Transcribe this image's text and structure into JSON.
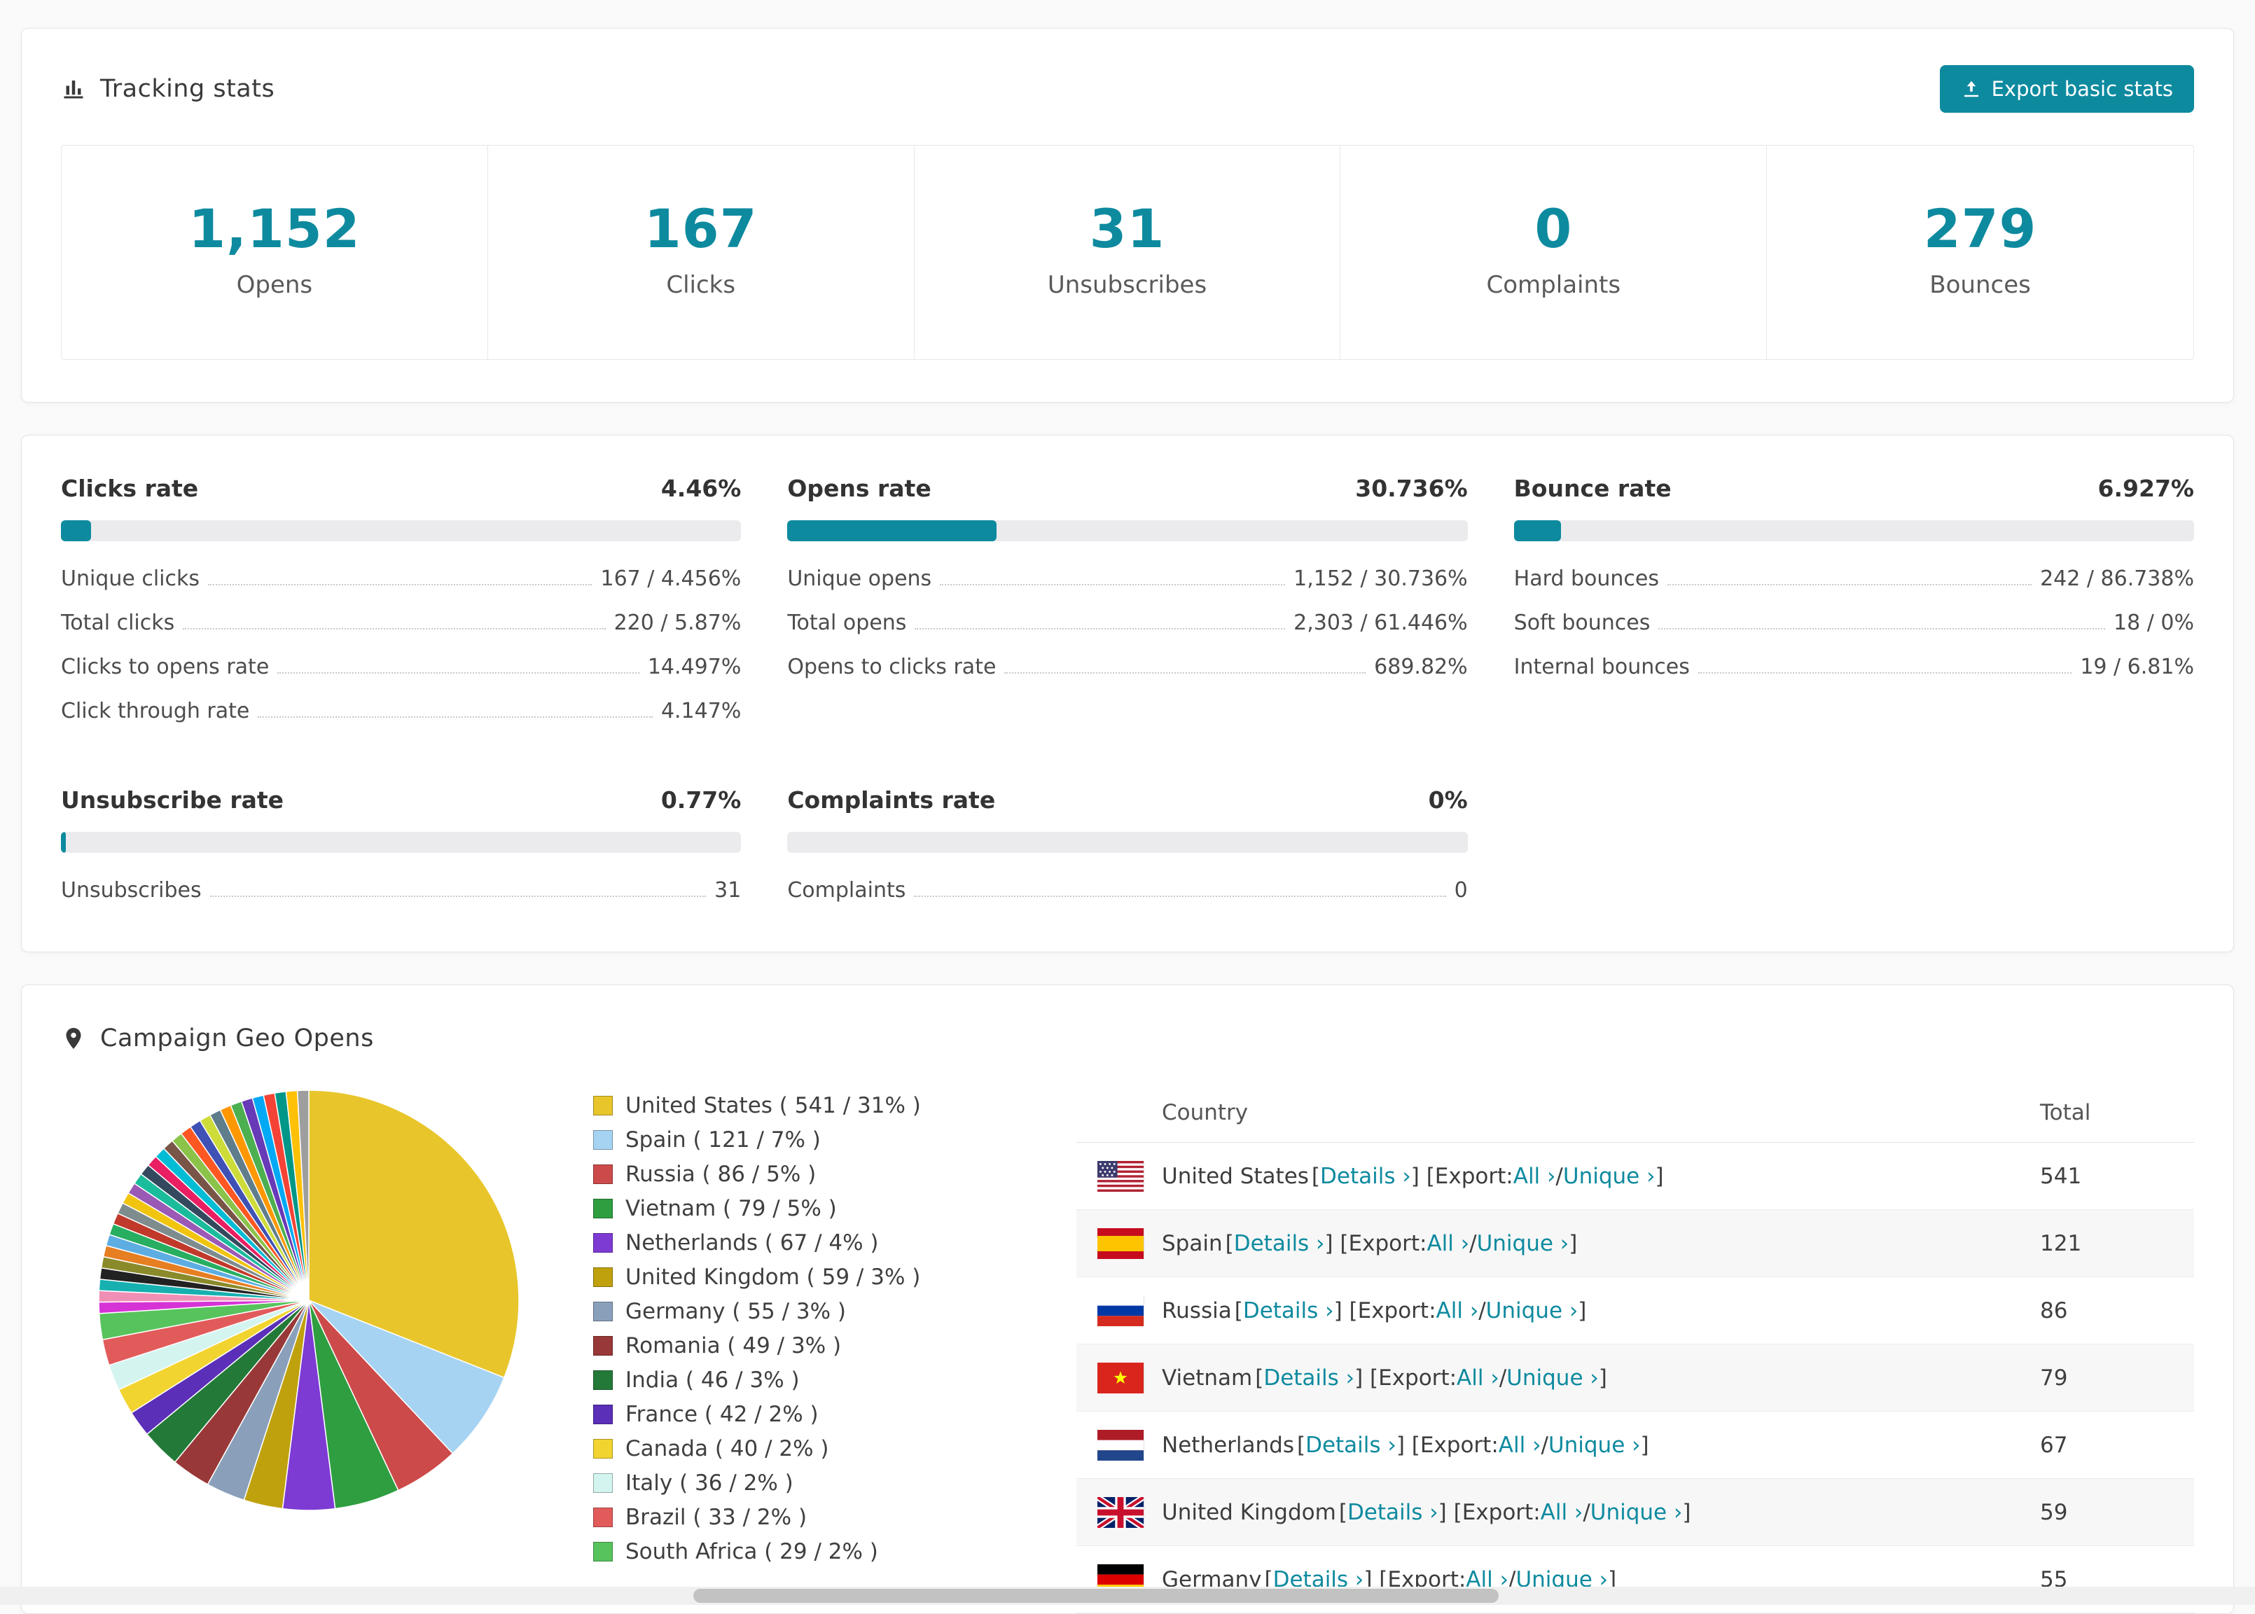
{
  "accent": "#0e8a9f",
  "tracking": {
    "title": "Tracking stats",
    "export_label": "Export basic stats",
    "stats": [
      {
        "value": "1,152",
        "label": "Opens"
      },
      {
        "value": "167",
        "label": "Clicks"
      },
      {
        "value": "31",
        "label": "Unsubscribes"
      },
      {
        "value": "0",
        "label": "Complaints"
      },
      {
        "value": "279",
        "label": "Bounces"
      }
    ]
  },
  "rates": [
    {
      "title": "Clicks rate",
      "value": "4.46%",
      "percent": 4.46,
      "rows": [
        {
          "label": "Unique clicks",
          "value": "167 / 4.456%"
        },
        {
          "label": "Total clicks",
          "value": "220 / 5.87%"
        },
        {
          "label": "Clicks to opens rate",
          "value": "14.497%"
        },
        {
          "label": "Click through rate",
          "value": "4.147%"
        }
      ]
    },
    {
      "title": "Opens rate",
      "value": "30.736%",
      "percent": 30.736,
      "rows": [
        {
          "label": "Unique opens",
          "value": "1,152 / 30.736%"
        },
        {
          "label": "Total opens",
          "value": "2,303 / 61.446%"
        },
        {
          "label": "Opens to clicks rate",
          "value": "689.82%"
        }
      ]
    },
    {
      "title": "Bounce rate",
      "value": "6.927%",
      "percent": 6.927,
      "rows": [
        {
          "label": "Hard bounces",
          "value": "242 / 86.738%"
        },
        {
          "label": "Soft bounces",
          "value": "18 / 0%"
        },
        {
          "label": "Internal bounces",
          "value": "19 / 6.81%"
        }
      ]
    },
    {
      "title": "Unsubscribe rate",
      "value": "0.77%",
      "percent": 0.77,
      "rows": [
        {
          "label": "Unsubscribes",
          "value": "31"
        }
      ]
    },
    {
      "title": "Complaints rate",
      "value": "0%",
      "percent": 0,
      "rows": [
        {
          "label": "Complaints",
          "value": "0"
        }
      ]
    }
  ],
  "geo": {
    "title": "Campaign Geo Opens",
    "table": {
      "headers": [
        "Country",
        "Total"
      ],
      "details_label": "Details",
      "export_label": "Export:",
      "all_label": "All",
      "unique_label": "Unique",
      "rows": [
        {
          "country": "United States",
          "total": "541",
          "flag": "us"
        },
        {
          "country": "Spain",
          "total": "121",
          "flag": "es"
        },
        {
          "country": "Russia",
          "total": "86",
          "flag": "ru"
        },
        {
          "country": "Vietnam",
          "total": "79",
          "flag": "vn"
        },
        {
          "country": "Netherlands",
          "total": "67",
          "flag": "nl"
        },
        {
          "country": "United Kingdom",
          "total": "59",
          "flag": "gb"
        },
        {
          "country": "Germany",
          "total": "55",
          "flag": "de"
        }
      ]
    }
  },
  "chart_data": {
    "type": "pie",
    "title": "Campaign Geo Opens",
    "labels": [
      "United States",
      "Spain",
      "Russia",
      "Vietnam",
      "Netherlands",
      "United Kingdom",
      "Germany",
      "Romania",
      "India",
      "France",
      "Canada",
      "Italy",
      "Brazil",
      "South Africa"
    ],
    "values": [
      541,
      121,
      86,
      79,
      67,
      59,
      55,
      49,
      46,
      42,
      40,
      36,
      33,
      29
    ],
    "percents": [
      31,
      7,
      5,
      5,
      4,
      3,
      3,
      3,
      3,
      2,
      2,
      2,
      2,
      2
    ],
    "colors": [
      "#e8c62b",
      "#a6d3f2",
      "#cd4a4a",
      "#2f9e41",
      "#7d3bd4",
      "#bfa10e",
      "#8aa0ba",
      "#993838",
      "#237a38",
      "#5b2fb8",
      "#f2d430",
      "#d4f4f0",
      "#e25b5b",
      "#57c35c"
    ],
    "legend_labels": [
      "United States ( 541 / 31% )",
      "Spain ( 121 / 7% )",
      "Russia ( 86 / 5% )",
      "Vietnam ( 79 / 5% )",
      "Netherlands ( 67 / 4% )",
      "United Kingdom ( 59 / 3% )",
      "Germany ( 55 / 3% )",
      "Romania ( 49 / 3% )",
      "India ( 46 / 3% )",
      "France ( 42 / 2% )",
      "Canada ( 40 / 2% )",
      "Italy ( 36 / 2% )",
      "Brazil ( 33 / 2% )",
      "South Africa ( 29 / 2% )"
    ],
    "others_percent": 26,
    "legend_position": "right",
    "start_angle_deg": 0,
    "direction": "clockwise"
  }
}
